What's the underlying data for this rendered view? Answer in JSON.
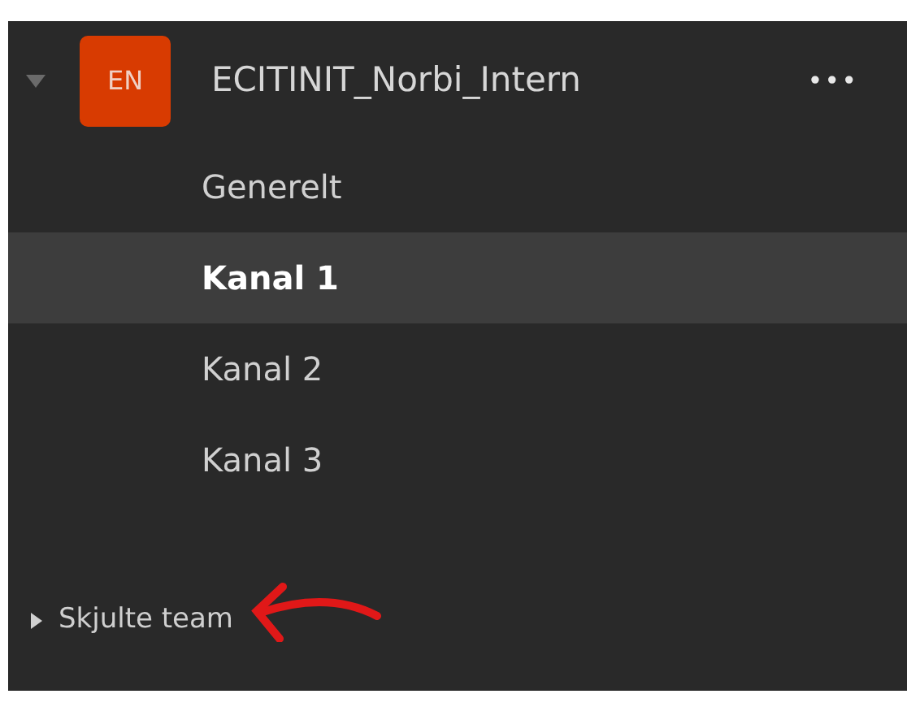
{
  "team": {
    "avatar": "EN",
    "name": "ECITINIT_Norbi_Intern",
    "more": "•••",
    "expanded": true
  },
  "channels": [
    {
      "name": "Generelt",
      "selected": false
    },
    {
      "name": "Kanal 1",
      "selected": true
    },
    {
      "name": "Kanal 2",
      "selected": false
    },
    {
      "name": "Kanal 3",
      "selected": false
    }
  ],
  "hidden_teams": {
    "label": "Skjulte team",
    "expanded": false
  }
}
